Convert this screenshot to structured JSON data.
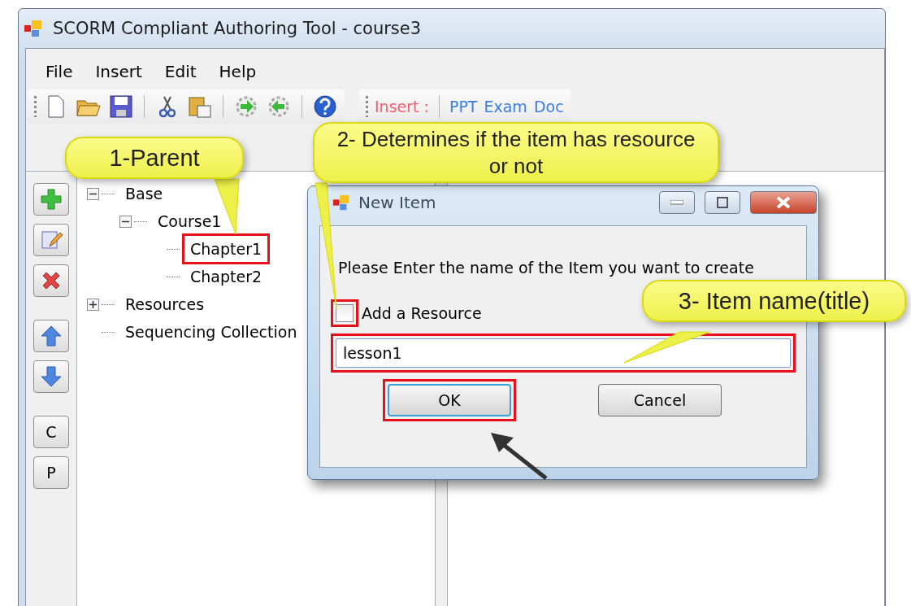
{
  "window": {
    "title": "SCORM Compliant Authoring Tool - course3"
  },
  "menu": [
    "File",
    "Insert",
    "Edit",
    "Help"
  ],
  "insert_bar": {
    "label": "Insert :",
    "links": [
      "PPT",
      "Exam",
      "Doc"
    ]
  },
  "side_buttons": [
    {
      "kind": "add"
    },
    {
      "kind": "edit"
    },
    {
      "kind": "delete"
    },
    {
      "kind": "up"
    },
    {
      "kind": "down"
    },
    {
      "kind": "letter",
      "label": "C"
    },
    {
      "kind": "letter",
      "label": "P"
    }
  ],
  "tree": [
    {
      "label": "Base",
      "expanded": true,
      "marked": false,
      "children": [
        {
          "label": "Course1",
          "expanded": true,
          "marked": false,
          "children": [
            {
              "label": "Chapter1",
              "marked": true
            },
            {
              "label": "Chapter2",
              "marked": false
            }
          ]
        }
      ]
    },
    {
      "label": "Resources",
      "expanded": false,
      "marked": false
    },
    {
      "label": "Sequencing Collection",
      "marked": false
    }
  ],
  "dialog": {
    "title": "New Item",
    "prompt": "Please Enter the name of the Item you want to create",
    "checkbox": {
      "label": "Add a Resource",
      "checked": false,
      "marked": true
    },
    "name_field": {
      "value": "lesson1",
      "marked": true
    },
    "buttons": [
      {
        "label": "OK",
        "default": true,
        "marked": true
      },
      {
        "label": "Cancel",
        "default": false,
        "marked": false
      }
    ]
  },
  "callouts": [
    {
      "text": "1-Parent"
    },
    {
      "text": "2- Determines if the item has resource or not"
    },
    {
      "text": "3- Item name(title)"
    }
  ]
}
